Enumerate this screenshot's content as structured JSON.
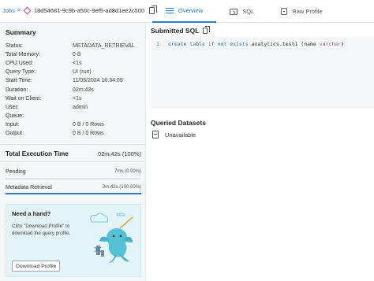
{
  "header": {
    "breadcrumb_root": "Jobs",
    "breadcrumb_sep": ">",
    "job_id": "18d54681-9c9b-a50c-9ef5-ad8d1ee2c500",
    "tabs": [
      {
        "label": "Overview",
        "icon": "overview-icon",
        "active": true
      },
      {
        "label": "SQL",
        "icon": "sql-icon",
        "active": false
      },
      {
        "label": "Raw Profile",
        "icon": "raw-profile-icon",
        "active": false
      }
    ],
    "accent_color": "#2a7bc4"
  },
  "summary": {
    "title": "Summary",
    "rows": [
      {
        "key": "Status:",
        "value": "METADATA_RETRIEVAL"
      },
      {
        "key": "Total Memory:",
        "value": "0 B"
      },
      {
        "key": "CPU Used:",
        "value": "<1s"
      },
      {
        "key": "Query Type:",
        "value": "UI (run)"
      },
      {
        "key": "Start Time:",
        "value": "11/05/2024 16:34:05"
      },
      {
        "key": "Duration:",
        "value": "02m:42s"
      },
      {
        "key": "Wait on Client:",
        "value": "<1s"
      },
      {
        "key": "User:",
        "value": "admin"
      },
      {
        "key": "Queue:",
        "value": ""
      },
      {
        "key": "Input:",
        "value": "0 B / 0 Rows"
      },
      {
        "key": "Output:",
        "value": "0 B / 0 Rows"
      }
    ]
  },
  "execution": {
    "title": "Total Execution Time",
    "total": "02m:42s (100%)",
    "phases": [
      {
        "label": "Pending",
        "value": "7ms (0.00%)",
        "fraction": 0.0
      },
      {
        "label": "Metadata Retrieval",
        "value": "2m:42s (100.00%)",
        "fraction": 1.0
      }
    ]
  },
  "help": {
    "title": "Need a hand?",
    "description": "Click \"Download Profile\" to download the query profile.",
    "button_label": "Download Profile",
    "illustration": "narwhal-mascot"
  },
  "sql": {
    "title": "Submitted SQL",
    "line_number": "1",
    "kw1": "create table if not exists",
    "plain1": " analytics.test1 (name ",
    "type1": "varchar",
    "plain2": ")"
  },
  "datasets": {
    "title": "Queried Datasets",
    "item": "Unavailable"
  }
}
